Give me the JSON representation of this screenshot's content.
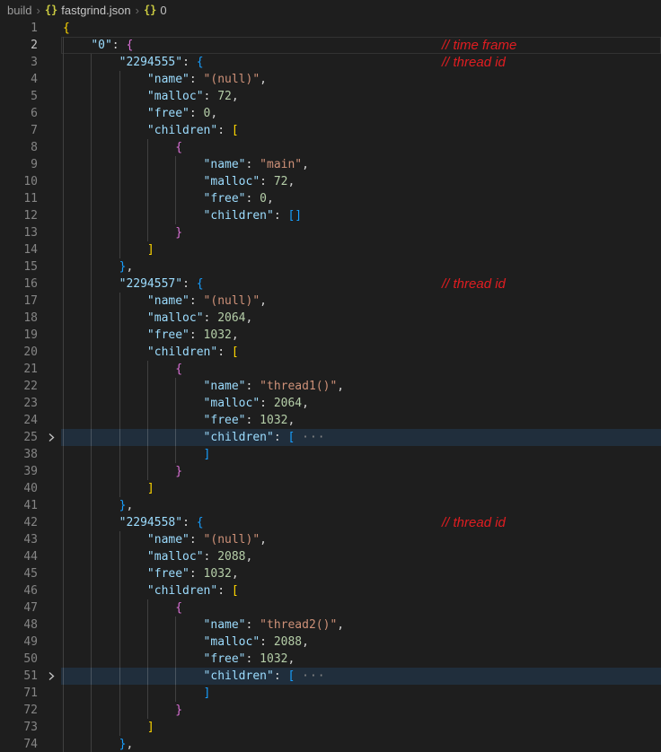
{
  "breadcrumb": {
    "items": [
      "build",
      "fastgrind.json",
      "0"
    ],
    "separator": "›",
    "icon_glyph": "{}"
  },
  "icons": {
    "json-object-icon": "{}",
    "fold-chevron-icon": "❯"
  },
  "colors": {
    "editor_background": "#1e1e1e",
    "fold_line_highlight": "#202e3c",
    "annotation_red": "#e11d21",
    "line_number": "#858585",
    "line_number_active": "#c6c6c6",
    "json_key": "#9cdcfe",
    "json_string": "#ce9178",
    "json_number": "#b5cea8",
    "bracket_level1": "#ffd700",
    "bracket_level2": "#da70d6",
    "bracket_level3": "#179fff",
    "indent_guide": "#404040",
    "breadcrumb_icon": "#cbcb41"
  },
  "editor": {
    "fold_placeholder": "···",
    "lines": [
      {
        "num": 1,
        "indent": 0,
        "tokens": [
          [
            "b1",
            "{"
          ]
        ]
      },
      {
        "num": 2,
        "indent": 4,
        "active": true,
        "annotation": "// time frame",
        "tokens": [
          [
            "k",
            "\"0\""
          ],
          [
            "p",
            ": "
          ],
          [
            "b2",
            "{"
          ]
        ]
      },
      {
        "num": 3,
        "indent": 8,
        "annotation": "// thread id",
        "tokens": [
          [
            "k",
            "\"2294555\""
          ],
          [
            "p",
            ": "
          ],
          [
            "b3",
            "{"
          ]
        ]
      },
      {
        "num": 4,
        "indent": 12,
        "tokens": [
          [
            "k",
            "\"name\""
          ],
          [
            "p",
            ": "
          ],
          [
            "s",
            "\"(null)\""
          ],
          [
            "p",
            ","
          ]
        ]
      },
      {
        "num": 5,
        "indent": 12,
        "tokens": [
          [
            "k",
            "\"malloc\""
          ],
          [
            "p",
            ": "
          ],
          [
            "n",
            "72"
          ],
          [
            "p",
            ","
          ]
        ]
      },
      {
        "num": 6,
        "indent": 12,
        "tokens": [
          [
            "k",
            "\"free\""
          ],
          [
            "p",
            ": "
          ],
          [
            "n",
            "0"
          ],
          [
            "p",
            ","
          ]
        ]
      },
      {
        "num": 7,
        "indent": 12,
        "tokens": [
          [
            "k",
            "\"children\""
          ],
          [
            "p",
            ": "
          ],
          [
            "b1",
            "["
          ]
        ]
      },
      {
        "num": 8,
        "indent": 16,
        "tokens": [
          [
            "b2",
            "{"
          ]
        ]
      },
      {
        "num": 9,
        "indent": 20,
        "tokens": [
          [
            "k",
            "\"name\""
          ],
          [
            "p",
            ": "
          ],
          [
            "s",
            "\"main\""
          ],
          [
            "p",
            ","
          ]
        ]
      },
      {
        "num": 10,
        "indent": 20,
        "tokens": [
          [
            "k",
            "\"malloc\""
          ],
          [
            "p",
            ": "
          ],
          [
            "n",
            "72"
          ],
          [
            "p",
            ","
          ]
        ]
      },
      {
        "num": 11,
        "indent": 20,
        "tokens": [
          [
            "k",
            "\"free\""
          ],
          [
            "p",
            ": "
          ],
          [
            "n",
            "0"
          ],
          [
            "p",
            ","
          ]
        ]
      },
      {
        "num": 12,
        "indent": 20,
        "tokens": [
          [
            "k",
            "\"children\""
          ],
          [
            "p",
            ": "
          ],
          [
            "b3",
            "[]"
          ]
        ]
      },
      {
        "num": 13,
        "indent": 16,
        "tokens": [
          [
            "b2",
            "}"
          ]
        ]
      },
      {
        "num": 14,
        "indent": 12,
        "tokens": [
          [
            "b1",
            "]"
          ]
        ]
      },
      {
        "num": 15,
        "indent": 8,
        "tokens": [
          [
            "b3",
            "}"
          ],
          [
            "p",
            ","
          ]
        ]
      },
      {
        "num": 16,
        "indent": 8,
        "annotation": "// thread id",
        "tokens": [
          [
            "k",
            "\"2294557\""
          ],
          [
            "p",
            ": "
          ],
          [
            "b3",
            "{"
          ]
        ]
      },
      {
        "num": 17,
        "indent": 12,
        "tokens": [
          [
            "k",
            "\"name\""
          ],
          [
            "p",
            ": "
          ],
          [
            "s",
            "\"(null)\""
          ],
          [
            "p",
            ","
          ]
        ]
      },
      {
        "num": 18,
        "indent": 12,
        "tokens": [
          [
            "k",
            "\"malloc\""
          ],
          [
            "p",
            ": "
          ],
          [
            "n",
            "2064"
          ],
          [
            "p",
            ","
          ]
        ]
      },
      {
        "num": 19,
        "indent": 12,
        "tokens": [
          [
            "k",
            "\"free\""
          ],
          [
            "p",
            ": "
          ],
          [
            "n",
            "1032"
          ],
          [
            "p",
            ","
          ]
        ]
      },
      {
        "num": 20,
        "indent": 12,
        "tokens": [
          [
            "k",
            "\"children\""
          ],
          [
            "p",
            ": "
          ],
          [
            "b1",
            "["
          ]
        ]
      },
      {
        "num": 21,
        "indent": 16,
        "tokens": [
          [
            "b2",
            "{"
          ]
        ]
      },
      {
        "num": 22,
        "indent": 20,
        "tokens": [
          [
            "k",
            "\"name\""
          ],
          [
            "p",
            ": "
          ],
          [
            "s",
            "\"thread1()\""
          ],
          [
            "p",
            ","
          ]
        ]
      },
      {
        "num": 23,
        "indent": 20,
        "tokens": [
          [
            "k",
            "\"malloc\""
          ],
          [
            "p",
            ": "
          ],
          [
            "n",
            "2064"
          ],
          [
            "p",
            ","
          ]
        ]
      },
      {
        "num": 24,
        "indent": 20,
        "tokens": [
          [
            "k",
            "\"free\""
          ],
          [
            "p",
            ": "
          ],
          [
            "n",
            "1032"
          ],
          [
            "p",
            ","
          ]
        ]
      },
      {
        "num": 25,
        "indent": 20,
        "folded": true,
        "tokens": [
          [
            "k",
            "\"children\""
          ],
          [
            "p",
            ": "
          ],
          [
            "b3",
            "["
          ],
          [
            "p",
            " "
          ],
          [
            "f",
            "···"
          ]
        ]
      },
      {
        "num": 38,
        "indent": 20,
        "tokens": [
          [
            "b3",
            "]"
          ]
        ]
      },
      {
        "num": 39,
        "indent": 16,
        "tokens": [
          [
            "b2",
            "}"
          ]
        ]
      },
      {
        "num": 40,
        "indent": 12,
        "tokens": [
          [
            "b1",
            "]"
          ]
        ]
      },
      {
        "num": 41,
        "indent": 8,
        "tokens": [
          [
            "b3",
            "}"
          ],
          [
            "p",
            ","
          ]
        ]
      },
      {
        "num": 42,
        "indent": 8,
        "annotation": "// thread id",
        "tokens": [
          [
            "k",
            "\"2294558\""
          ],
          [
            "p",
            ": "
          ],
          [
            "b3",
            "{"
          ]
        ]
      },
      {
        "num": 43,
        "indent": 12,
        "tokens": [
          [
            "k",
            "\"name\""
          ],
          [
            "p",
            ": "
          ],
          [
            "s",
            "\"(null)\""
          ],
          [
            "p",
            ","
          ]
        ]
      },
      {
        "num": 44,
        "indent": 12,
        "tokens": [
          [
            "k",
            "\"malloc\""
          ],
          [
            "p",
            ": "
          ],
          [
            "n",
            "2088"
          ],
          [
            "p",
            ","
          ]
        ]
      },
      {
        "num": 45,
        "indent": 12,
        "tokens": [
          [
            "k",
            "\"free\""
          ],
          [
            "p",
            ": "
          ],
          [
            "n",
            "1032"
          ],
          [
            "p",
            ","
          ]
        ]
      },
      {
        "num": 46,
        "indent": 12,
        "tokens": [
          [
            "k",
            "\"children\""
          ],
          [
            "p",
            ": "
          ],
          [
            "b1",
            "["
          ]
        ]
      },
      {
        "num": 47,
        "indent": 16,
        "tokens": [
          [
            "b2",
            "{"
          ]
        ]
      },
      {
        "num": 48,
        "indent": 20,
        "tokens": [
          [
            "k",
            "\"name\""
          ],
          [
            "p",
            ": "
          ],
          [
            "s",
            "\"thread2()\""
          ],
          [
            "p",
            ","
          ]
        ]
      },
      {
        "num": 49,
        "indent": 20,
        "tokens": [
          [
            "k",
            "\"malloc\""
          ],
          [
            "p",
            ": "
          ],
          [
            "n",
            "2088"
          ],
          [
            "p",
            ","
          ]
        ]
      },
      {
        "num": 50,
        "indent": 20,
        "tokens": [
          [
            "k",
            "\"free\""
          ],
          [
            "p",
            ": "
          ],
          [
            "n",
            "1032"
          ],
          [
            "p",
            ","
          ]
        ]
      },
      {
        "num": 51,
        "indent": 20,
        "folded": true,
        "tokens": [
          [
            "k",
            "\"children\""
          ],
          [
            "p",
            ": "
          ],
          [
            "b3",
            "["
          ],
          [
            "p",
            " "
          ],
          [
            "f",
            "···"
          ]
        ]
      },
      {
        "num": 71,
        "indent": 20,
        "tokens": [
          [
            "b3",
            "]"
          ]
        ]
      },
      {
        "num": 72,
        "indent": 16,
        "tokens": [
          [
            "b2",
            "}"
          ]
        ]
      },
      {
        "num": 73,
        "indent": 12,
        "tokens": [
          [
            "b1",
            "]"
          ]
        ]
      },
      {
        "num": 74,
        "indent": 8,
        "tokens": [
          [
            "b3",
            "}"
          ],
          [
            "p",
            ","
          ]
        ]
      }
    ]
  }
}
